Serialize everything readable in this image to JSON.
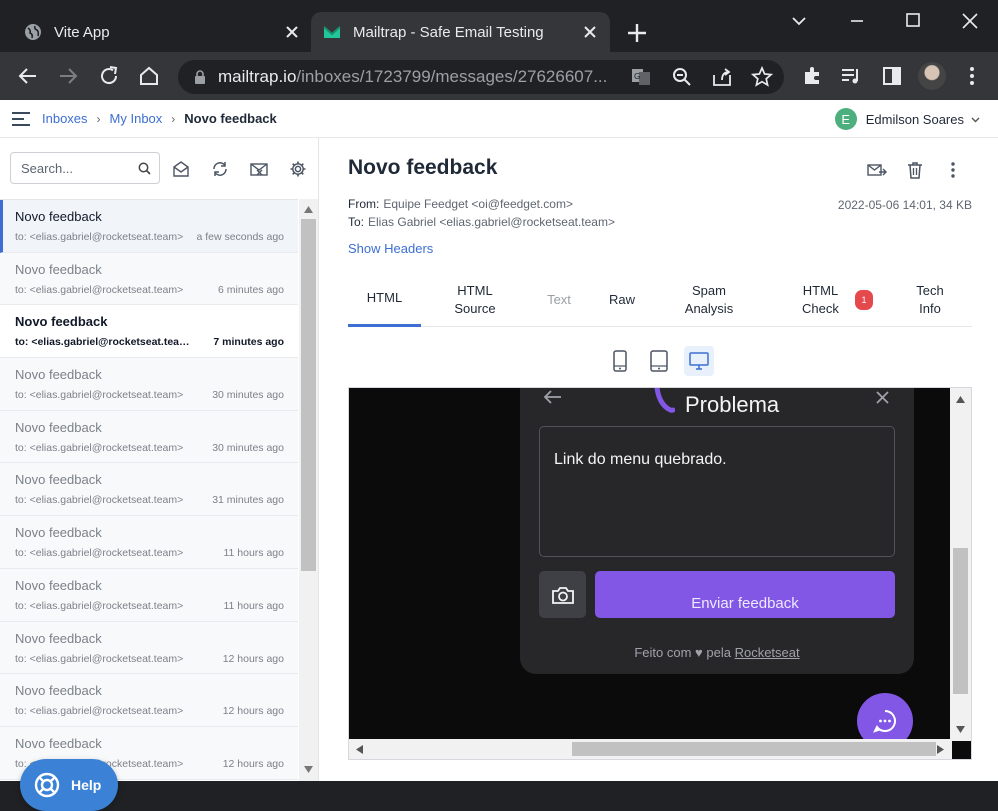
{
  "browser": {
    "tabs": [
      {
        "title": "Vite App",
        "active": false
      },
      {
        "title": "Mailtrap - Safe Email Testing",
        "active": true
      }
    ],
    "url_host": "mailtrap.io",
    "url_path": "/inboxes/1723799/messages/27626607..."
  },
  "header": {
    "breadcrumbs": [
      "Inboxes",
      "My Inbox",
      "Novo feedback"
    ],
    "user_initial": "E",
    "user_name": "Edmilson Soares"
  },
  "sidebar": {
    "search_placeholder": "Search...",
    "messages": [
      {
        "subject": "Novo feedback",
        "to": "to: <elias.gabriel@rocketseat.team>",
        "time": "a few seconds ago",
        "state": "selected"
      },
      {
        "subject": "Novo feedback",
        "to": "to: <elias.gabriel@rocketseat.team>",
        "time": "6 minutes ago",
        "state": "read"
      },
      {
        "subject": "Novo feedback",
        "to": "to: <elias.gabriel@rocketseat.team>",
        "time": "7 minutes ago",
        "state": "unread"
      },
      {
        "subject": "Novo feedback",
        "to": "to: <elias.gabriel@rocketseat.team>",
        "time": "30 minutes ago",
        "state": "read"
      },
      {
        "subject": "Novo feedback",
        "to": "to: <elias.gabriel@rocketseat.team>",
        "time": "30 minutes ago",
        "state": "read"
      },
      {
        "subject": "Novo feedback",
        "to": "to: <elias.gabriel@rocketseat.team>",
        "time": "31 minutes ago",
        "state": "read"
      },
      {
        "subject": "Novo feedback",
        "to": "to: <elias.gabriel@rocketseat.team>",
        "time": "11 hours ago",
        "state": "read"
      },
      {
        "subject": "Novo feedback",
        "to": "to: <elias.gabriel@rocketseat.team>",
        "time": "11 hours ago",
        "state": "read"
      },
      {
        "subject": "Novo feedback",
        "to": "to: <elias.gabriel@rocketseat.team>",
        "time": "12 hours ago",
        "state": "read"
      },
      {
        "subject": "Novo feedback",
        "to": "to: <elias.gabriel@rocketseat.team>",
        "time": "12 hours ago",
        "state": "read"
      },
      {
        "subject": "Novo feedback",
        "to": "to: <elias.gabriel@rocketseat.team>",
        "time": "12 hours ago",
        "state": "read"
      }
    ],
    "help_label": "Help"
  },
  "message": {
    "subject": "Novo feedback",
    "from_label": "From:",
    "from": "Equipe Feedget <oi@feedget.com>",
    "to_label": "To:",
    "to": "Elias Gabriel <elias.gabriel@rocketseat.team>",
    "meta": "2022-05-06 14:01, 34 KB",
    "show_headers": "Show Headers",
    "tabs": [
      {
        "label": "HTML",
        "state": "active"
      },
      {
        "label": "HTML Source",
        "state": "normal"
      },
      {
        "label": "Text",
        "state": "disabled"
      },
      {
        "label": "Raw",
        "state": "normal"
      },
      {
        "label": "Spam Analysis",
        "state": "normal"
      },
      {
        "label": "HTML Check",
        "state": "normal",
        "badge": "1"
      },
      {
        "label": "Tech Info",
        "state": "normal"
      }
    ]
  },
  "preview": {
    "widget_title": "Problema",
    "textarea_text": "Link do menu quebrado.",
    "send_button": "Enviar feedback",
    "footer_prefix": "Feito com ♥ pela",
    "footer_brand": "Rocketseat"
  },
  "colors": {
    "accent": "#3c6fd1",
    "brand_purple": "#8257e6",
    "badge_red": "#e5484d"
  }
}
